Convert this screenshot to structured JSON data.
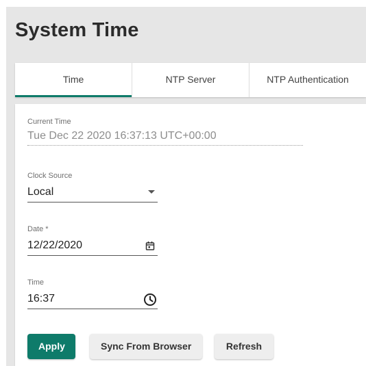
{
  "page": {
    "title": "System Time"
  },
  "tabs": [
    {
      "label": "Time",
      "active": true
    },
    {
      "label": "NTP Server",
      "active": false
    },
    {
      "label": "NTP Authentication",
      "active": false
    }
  ],
  "form": {
    "current_time": {
      "label": "Current Time",
      "value": "Tue Dec 22 2020 16:37:13 UTC+00:00"
    },
    "clock_source": {
      "label": "Clock Source",
      "value": "Local",
      "icon": "dropdown-arrow-icon"
    },
    "date": {
      "label": "Date *",
      "value": "12/22/2020",
      "icon": "calendar-icon"
    },
    "time": {
      "label": "Time",
      "value": "16:37",
      "icon": "clock-icon"
    }
  },
  "buttons": {
    "apply": "Apply",
    "sync": "Sync From Browser",
    "refresh": "Refresh"
  },
  "colors": {
    "accent": "#0e7b6a",
    "page_background": "#e6e6e6",
    "card": "#ffffff",
    "secondary_button": "#eeeeee"
  }
}
